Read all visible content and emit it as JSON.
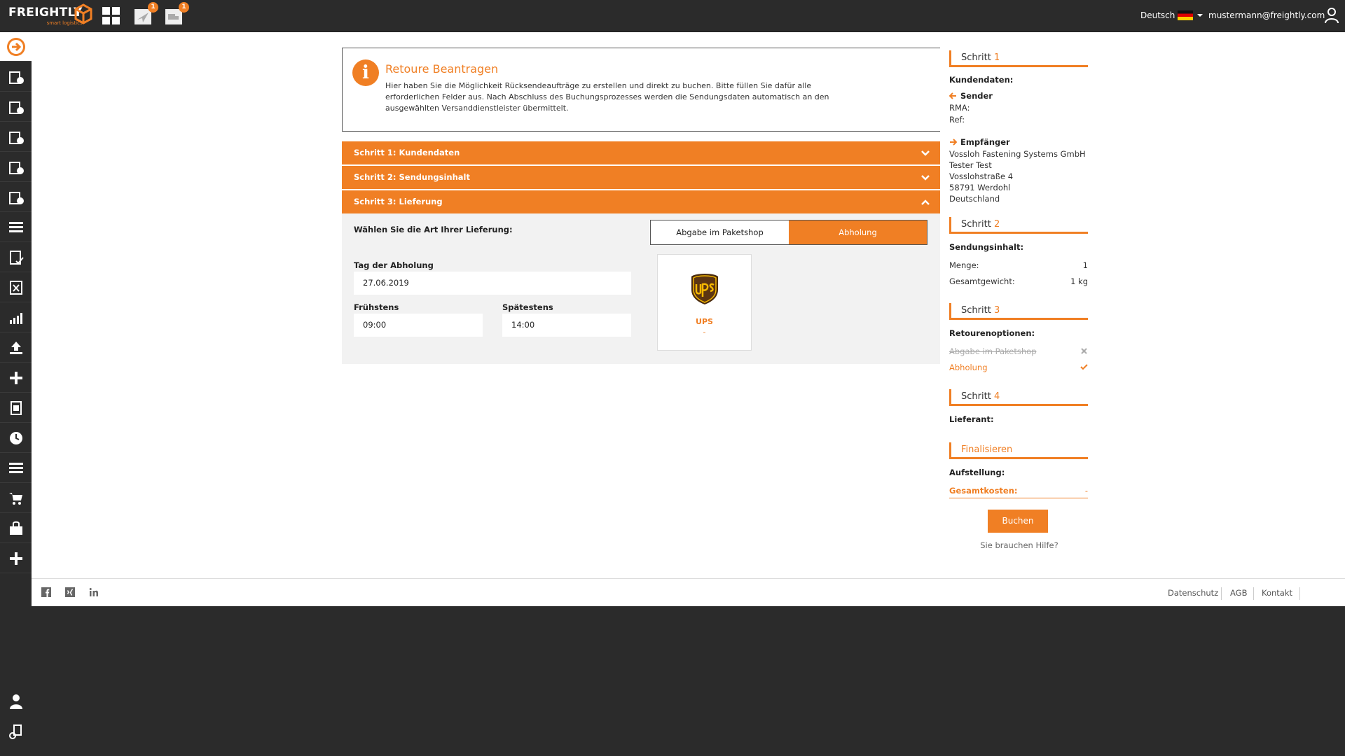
{
  "header": {
    "logo_text": "FREIGHTLY",
    "logo_sub": "smart logistics",
    "notifications": [
      {
        "icon": "paper-plane-icon",
        "count": "1"
      },
      {
        "icon": "truck-icon",
        "count": "1"
      }
    ],
    "language": "Deutsch",
    "user_email": "mustermann@freightly.com"
  },
  "sidebar": {
    "items": [
      "arrow-right-circle-icon",
      "box-add-icon",
      "box-add-alt-icon",
      "box-edit-icon",
      "box-settings-icon",
      "box-info-icon",
      "list-icon",
      "document-check-icon",
      "excel-icon",
      "chart-icon",
      "upload-icon",
      "plus-icon",
      "document-icon",
      "clock-icon",
      "list-alt-icon",
      "cart-icon",
      "shopping-bag-icon",
      "plus-alt-icon"
    ],
    "bottom": [
      "user-icon",
      "user-settings-icon"
    ]
  },
  "info": {
    "title": "Retoure Beantragen",
    "text": "Hier haben Sie die Möglichkeit Rücksendeaufträge zu erstellen und direkt zu buchen. Bitte füllen Sie dafür alle erforderlichen Felder aus. Nach Abschluss des Buchungsprozesses werden die Sendungsdaten automatisch an den ausgewählten Versanddienstleister übermittelt."
  },
  "accordion": {
    "step1": "Schritt 1: Kundendaten",
    "step2": "Schritt 2: Sendungsinhalt",
    "step3": "Schritt 3: Lieferung"
  },
  "delivery": {
    "question": "Wählen Sie die Art Ihrer Lieferung:",
    "option_shop": "Abgabe im Paketshop",
    "option_pickup": "Abholung",
    "day_label": "Tag der Abholung",
    "day_value": "27.06.2019",
    "earliest_label": "Frühstens",
    "earliest_value": "09:00",
    "latest_label": "Spätestens",
    "latest_value": "14:00",
    "carrier_name": "UPS",
    "carrier_price": "-"
  },
  "summary": {
    "step_word": "Schritt",
    "step1_num": "1",
    "kundendaten": "Kundendaten:",
    "sender_label": "Sender",
    "rma": "RMA:",
    "ref": "Ref:",
    "receiver_label": "Empfänger",
    "receiver_lines": [
      "Vossloh Fastening Systems GmbH",
      "Tester Test",
      "Vosslohstraße 4",
      "58791 Werdohl",
      "Deutschland"
    ],
    "step2_num": "2",
    "sendungsinhalt": "Sendungsinhalt:",
    "menge_label": "Menge:",
    "menge_value": "1",
    "gewicht_label": "Gesamtgewicht:",
    "gewicht_value": "1 kg",
    "step3_num": "3",
    "retourenoptionen": "Retourenoptionen:",
    "opt_shop": "Abgabe im Paketshop",
    "opt_pickup": "Abholung",
    "step4_num": "4",
    "lieferant": "Lieferant:",
    "finalisieren": "Finalisieren",
    "aufstellung": "Aufstellung:",
    "gesamtkosten_label": "Gesamtkosten:",
    "gesamtkosten_value": "-",
    "book_button": "Buchen",
    "help": "Sie brauchen Hilfe?"
  },
  "footer": {
    "links": [
      "Datenschutz",
      "AGB",
      "Kontakt"
    ]
  },
  "colors": {
    "accent": "#f07f24",
    "dark": "#2b2b2b"
  }
}
